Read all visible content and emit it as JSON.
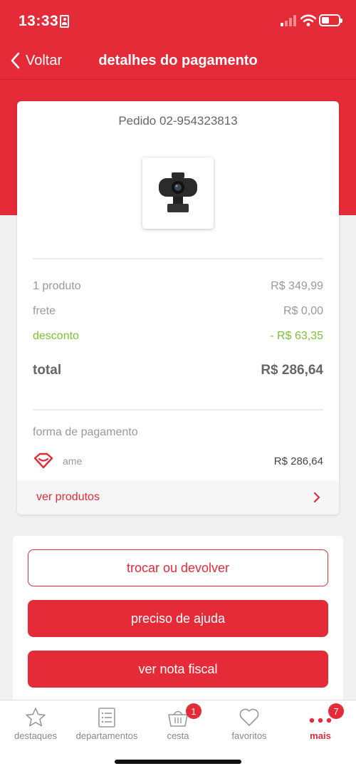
{
  "status_bar": {
    "time": "13:33"
  },
  "nav": {
    "back_label": "Voltar",
    "title": "detalhes do pagamento"
  },
  "order": {
    "label": "Pedido 02-954323813"
  },
  "summary": {
    "products_label": "1 produto",
    "products_value": "R$ 349,99",
    "shipping_label": "frete",
    "shipping_value": "R$ 0,00",
    "discount_label": "desconto",
    "discount_value": "- R$ 63,35",
    "total_label": "total",
    "total_value": "R$ 286,64"
  },
  "payment": {
    "label": "forma de pagamento",
    "method": "ame",
    "amount": "R$ 286,64"
  },
  "view_products": "ver produtos",
  "actions": {
    "return": "trocar ou devolver",
    "help": "preciso de ajuda",
    "invoice": "ver nota fiscal"
  },
  "tabbar": {
    "items": [
      {
        "label": "destaques",
        "icon": "star-icon"
      },
      {
        "label": "departamentos",
        "icon": "list-icon"
      },
      {
        "label": "cesta",
        "icon": "basket-icon",
        "badge": "1"
      },
      {
        "label": "favoritos",
        "icon": "heart-icon"
      },
      {
        "label": "mais",
        "icon": "more-icon",
        "badge": "7",
        "active": true
      }
    ]
  },
  "colors": {
    "brand": "#e52b38",
    "discount": "#7dc236"
  }
}
